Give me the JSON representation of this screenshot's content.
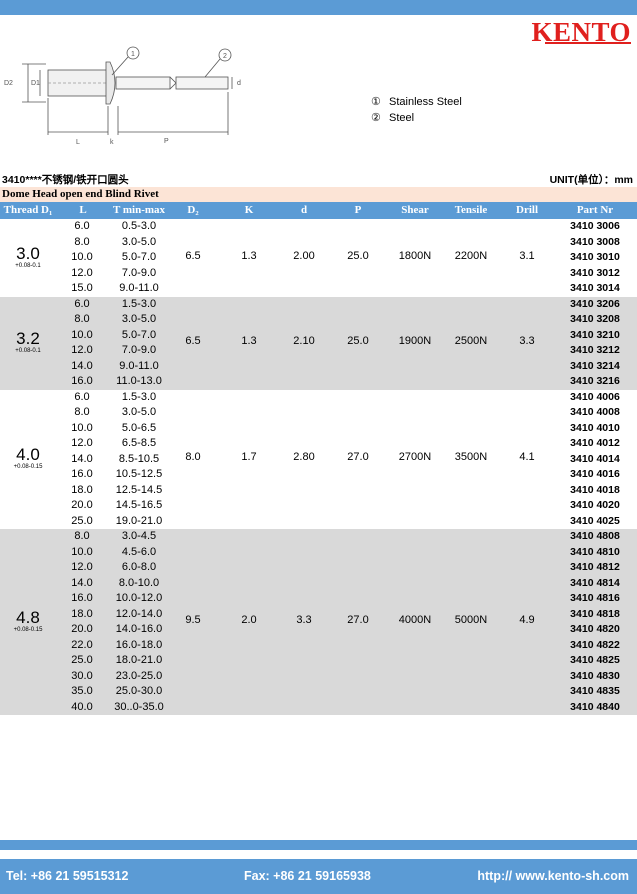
{
  "brand": "KENTO",
  "legend": [
    {
      "num": "①",
      "label": "Stainless Steel"
    },
    {
      "num": "②",
      "label": "Steel"
    }
  ],
  "drawing_labels": {
    "callout1": "1",
    "callout2": "2",
    "d2": "D2",
    "d1": "D1",
    "d": "d",
    "l": "L",
    "k": "k",
    "p": "P"
  },
  "subtitle": "3410****不锈钢/铁开口圆头",
  "unit": "UNIT(单位）：mm",
  "band_title": "Dome Head open end Blind Rivet",
  "headers": [
    "Thread D₁",
    "L",
    "T min-max",
    "D₂",
    "K",
    "d",
    "P",
    "Shear",
    "Tensile",
    "Drill",
    "Part Nr"
  ],
  "groups": [
    {
      "diameter": "3.0",
      "tolerance": "+0.08-0.1",
      "d2": "6.5",
      "k": "1.3",
      "d": "2.00",
      "p": "25.0",
      "shear": "1800N",
      "tensile": "2200N",
      "drill": "3.1",
      "rows": [
        [
          "6.0",
          "0.5-3.0",
          "3410 3006"
        ],
        [
          "8.0",
          "3.0-5.0",
          "3410 3008"
        ],
        [
          "10.0",
          "5.0-7.0",
          "3410 3010"
        ],
        [
          "12.0",
          "7.0-9.0",
          "3410 3012"
        ],
        [
          "15.0",
          "9.0-11.0",
          "3410 3014"
        ]
      ]
    },
    {
      "diameter": "3.2",
      "tolerance": "+0.08-0.1",
      "d2": "6.5",
      "k": "1.3",
      "d": "2.10",
      "p": "25.0",
      "shear": "1900N",
      "tensile": "2500N",
      "drill": "3.3",
      "rows": [
        [
          "6.0",
          "1.5-3.0",
          "3410 3206"
        ],
        [
          "8.0",
          "3.0-5.0",
          "3410 3208"
        ],
        [
          "10.0",
          "5.0-7.0",
          "3410 3210"
        ],
        [
          "12.0",
          "7.0-9.0",
          "3410 3212"
        ],
        [
          "14.0",
          "9.0-11.0",
          "3410 3214"
        ],
        [
          "16.0",
          "11.0-13.0",
          "3410 3216"
        ]
      ]
    },
    {
      "diameter": "4.0",
      "tolerance": "+0.08-0.15",
      "d2": "8.0",
      "k": "1.7",
      "d": "2.80",
      "p": "27.0",
      "shear": "2700N",
      "tensile": "3500N",
      "drill": "4.1",
      "rows": [
        [
          "6.0",
          "1.5-3.0",
          "3410 4006"
        ],
        [
          "8.0",
          "3.0-5.0",
          "3410 4008"
        ],
        [
          "10.0",
          "5.0-6.5",
          "3410 4010"
        ],
        [
          "12.0",
          "6.5-8.5",
          "3410 4012"
        ],
        [
          "14.0",
          "8.5-10.5",
          "3410 4014"
        ],
        [
          "16.0",
          "10.5-12.5",
          "3410 4016"
        ],
        [
          "18.0",
          "12.5-14.5",
          "3410 4018"
        ],
        [
          "20.0",
          "14.5-16.5",
          "3410 4020"
        ],
        [
          "25.0",
          "19.0-21.0",
          "3410 4025"
        ]
      ]
    },
    {
      "diameter": "4.8",
      "tolerance": "+0.08-0.15",
      "d2": "9.5",
      "k": "2.0",
      "d": "3.3",
      "p": "27.0",
      "shear": "4000N",
      "tensile": "5000N",
      "drill": "4.9",
      "rows": [
        [
          "8.0",
          "3.0-4.5",
          "3410 4808"
        ],
        [
          "10.0",
          "4.5-6.0",
          "3410 4810"
        ],
        [
          "12.0",
          "6.0-8.0",
          "3410 4812"
        ],
        [
          "14.0",
          "8.0-10.0",
          "3410 4814"
        ],
        [
          "16.0",
          "10.0-12.0",
          "3410 4816"
        ],
        [
          "18.0",
          "12.0-14.0",
          "3410 4818"
        ],
        [
          "20.0",
          "14.0-16.0",
          "3410 4820"
        ],
        [
          "22.0",
          "16.0-18.0",
          "3410 4822"
        ],
        [
          "25.0",
          "18.0-21.0",
          "3410 4825"
        ],
        [
          "30.0",
          "23.0-25.0",
          "3410 4830"
        ],
        [
          "35.0",
          "25.0-30.0",
          "3410 4835"
        ],
        [
          "40.0",
          "30..0-35.0",
          "3410 4840"
        ]
      ]
    }
  ],
  "footer": {
    "tel": "Tel: +86 21 59515312",
    "fax": "Fax: +86 21 59165938",
    "web": "http:// www.kento-sh.com"
  },
  "colors": {
    "accent": "#5b9bd5",
    "brand": "#e0201e",
    "band": "#fce4d6",
    "gray_row": "#d9d9d9"
  }
}
